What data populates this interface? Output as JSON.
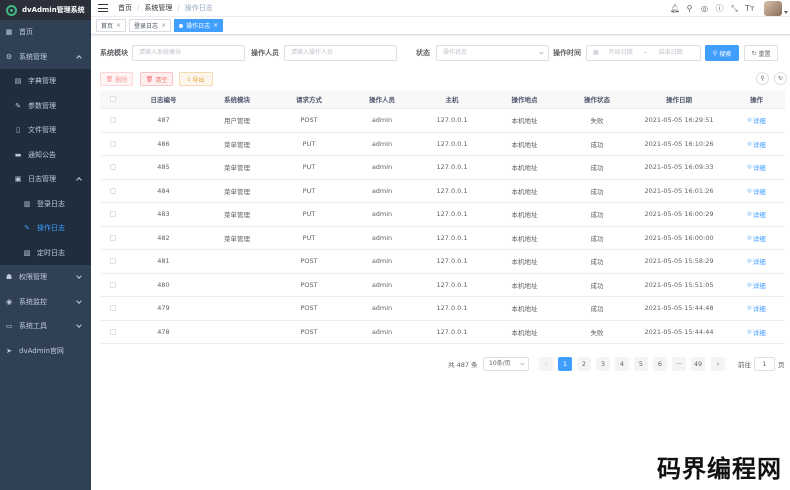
{
  "app": {
    "title": "dvAdmin管理系统"
  },
  "sidebar": {
    "items": [
      {
        "label": "首页",
        "icon": "dashboard-icon"
      },
      {
        "label": "系统管理",
        "icon": "gear-icon"
      },
      {
        "label": "字典管理",
        "icon": "book-icon"
      },
      {
        "label": "参数管理",
        "icon": "edit-icon"
      },
      {
        "label": "文件管理",
        "icon": "file-icon"
      },
      {
        "label": "通知公告",
        "icon": "message-icon"
      },
      {
        "label": "日志管理",
        "icon": "log-icon"
      },
      {
        "label": "登录日志",
        "icon": "login-log-icon"
      },
      {
        "label": "操作日志",
        "icon": "operation-log-icon"
      },
      {
        "label": "定时日志",
        "icon": "clock-icon"
      },
      {
        "label": "权限管理",
        "icon": "users-icon"
      },
      {
        "label": "系统监控",
        "icon": "monitor-icon"
      },
      {
        "label": "系统工具",
        "icon": "tool-icon"
      },
      {
        "label": "dvAdmin官网",
        "icon": "send-icon"
      }
    ]
  },
  "navbar": {
    "breadcrumb": [
      "首页",
      "系统管理",
      "操作日志"
    ],
    "icons": [
      "bell-icon",
      "search-icon",
      "github-icon",
      "help-icon",
      "fullscreen-icon",
      "font-size-icon"
    ]
  },
  "tags": [
    {
      "label": "首页"
    },
    {
      "label": "登录日志"
    },
    {
      "label": "操作日志"
    }
  ],
  "search": {
    "module_label": "系统模块",
    "module_placeholder": "请输入系统模块",
    "operator_label": "操作人员",
    "operator_placeholder": "请输入操作人员",
    "status_label": "状态",
    "status_placeholder": "操作状态",
    "time_label": "操作时间",
    "start_placeholder": "开始日期",
    "range_sep": "-",
    "end_placeholder": "结束日期",
    "search_btn": "搜索",
    "reset_btn": "重置"
  },
  "toolbar": {
    "delete_btn": "删除",
    "clear_btn": "清空",
    "export_btn": "导出"
  },
  "table": {
    "columns": [
      "日志编号",
      "系统模块",
      "请求方式",
      "操作人员",
      "主机",
      "操作地点",
      "操作状态",
      "操作日期",
      "操作"
    ],
    "rows": [
      [
        "487",
        "用户管理",
        "POST",
        "admin",
        "127.0.0.1",
        "本机地址",
        "失败",
        "2021-05-05 16:29:51",
        "详细"
      ],
      [
        "486",
        "菜单管理",
        "PUT",
        "admin",
        "127.0.0.1",
        "本机地址",
        "成功",
        "2021-05-05 16:10:26",
        "详细"
      ],
      [
        "485",
        "菜单管理",
        "PUT",
        "admin",
        "127.0.0.1",
        "本机地址",
        "成功",
        "2021-05-05 16:09:33",
        "详细"
      ],
      [
        "484",
        "菜单管理",
        "PUT",
        "admin",
        "127.0.0.1",
        "本机地址",
        "成功",
        "2021-05-05 16:01:26",
        "详细"
      ],
      [
        "483",
        "菜单管理",
        "PUT",
        "admin",
        "127.0.0.1",
        "本机地址",
        "成功",
        "2021-05-05 16:00:29",
        "详细"
      ],
      [
        "482",
        "菜单管理",
        "PUT",
        "admin",
        "127.0.0.1",
        "本机地址",
        "成功",
        "2021-05-05 16:00:00",
        "详细"
      ],
      [
        "481",
        "",
        "POST",
        "admin",
        "127.0.0.1",
        "本机地址",
        "成功",
        "2021-05-05 15:58:29",
        "详细"
      ],
      [
        "480",
        "",
        "POST",
        "admin",
        "127.0.0.1",
        "本机地址",
        "成功",
        "2021-05-05 15:51:05",
        "详细"
      ],
      [
        "479",
        "",
        "POST",
        "admin",
        "127.0.0.1",
        "本机地址",
        "成功",
        "2021-05-05 15:44:48",
        "详细"
      ],
      [
        "478",
        "",
        "POST",
        "admin",
        "127.0.0.1",
        "本机地址",
        "失败",
        "2021-05-05 15:44:44",
        "详细"
      ]
    ]
  },
  "pagination": {
    "total": "共 487 条",
    "page_size": "10条/页",
    "pages": [
      "1",
      "2",
      "3",
      "4",
      "5",
      "6",
      "···",
      "49"
    ],
    "current_page": "1",
    "goto_label": "前往",
    "goto_value": "1",
    "page_unit": "页",
    "prev": "‹",
    "next": "›"
  },
  "watermark": "码界编程网"
}
